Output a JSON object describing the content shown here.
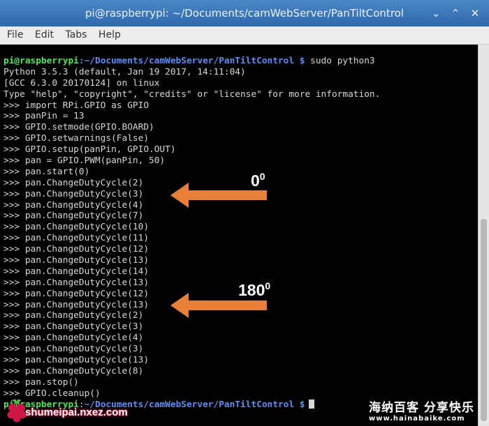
{
  "window": {
    "title": "pi@raspberrypi: ~/Documents/camWebServer/PanTiltControl",
    "minimize_glyph": "⌄",
    "maximize_glyph": "⌃",
    "close_glyph": "✕"
  },
  "menu": {
    "items": [
      "File",
      "Edit",
      "Tabs",
      "Help"
    ]
  },
  "prompt": {
    "user": "pi@raspberrypi",
    "path": ":~/Documents/camWebServer/PanTiltControl $",
    "first_command": " sudo python3",
    "last_line_path": "~/Documents/camWebServer/PanTiltControl $"
  },
  "terminal_lines": [
    "Python 3.5.3 (default, Jan 19 2017, 14:11:04)",
    "[GCC 6.3.0 20170124] on linux",
    "Type \"help\", \"copyright\", \"credits\" or \"license\" for more information.",
    ">>> import RPi.GPIO as GPIO",
    ">>> panPin = 13",
    ">>> GPIO.setmode(GPIO.BOARD)",
    ">>> GPIO.setwarnings(False)",
    ">>> GPIO.setup(panPin, GPIO.OUT)",
    ">>> pan = GPIO.PWM(panPin, 50)",
    ">>> pan.start(0)",
    ">>> pan.ChangeDutyCycle(2)",
    ">>> pan.ChangeDutyCycle(3)",
    ">>> pan.ChangeDutyCycle(4)",
    ">>> pan.ChangeDutyCycle(7)",
    ">>> pan.ChangeDutyCycle(10)",
    ">>> pan.ChangeDutyCycle(11)",
    ">>> pan.ChangeDutyCycle(12)",
    ">>> pan.ChangeDutyCycle(13)",
    ">>> pan.ChangeDutyCycle(14)",
    ">>> pan.ChangeDutyCycle(13)",
    ">>> pan.ChangeDutyCycle(12)",
    ">>> pan.ChangeDutyCycle(13)",
    ">>> pan.ChangeDutyCycle(2)",
    ">>> pan.ChangeDutyCycle(3)",
    ">>> pan.ChangeDutyCycle(4)",
    ">>> pan.ChangeDutyCycle(3)",
    ">>> pan.ChangeDutyCycle(13)",
    ">>> pan.ChangeDutyCycle(8)",
    ">>> pan.stop()",
    ">>> GPIO.cleanup()"
  ],
  "annotations": {
    "label_0": {
      "value": "0",
      "sup": "0"
    },
    "label_180": {
      "value": "180",
      "sup": "0"
    },
    "arrow_color": "#e8803a"
  },
  "watermark": {
    "left_text": "shumeipai.nxez.com",
    "right_cn": "海纳百客 分享快乐",
    "right_url": "www.hainabaike.com"
  },
  "colors": {
    "user": "#4fe85a",
    "path": "#5c8ef5",
    "titlebar": "#3b78bb"
  }
}
